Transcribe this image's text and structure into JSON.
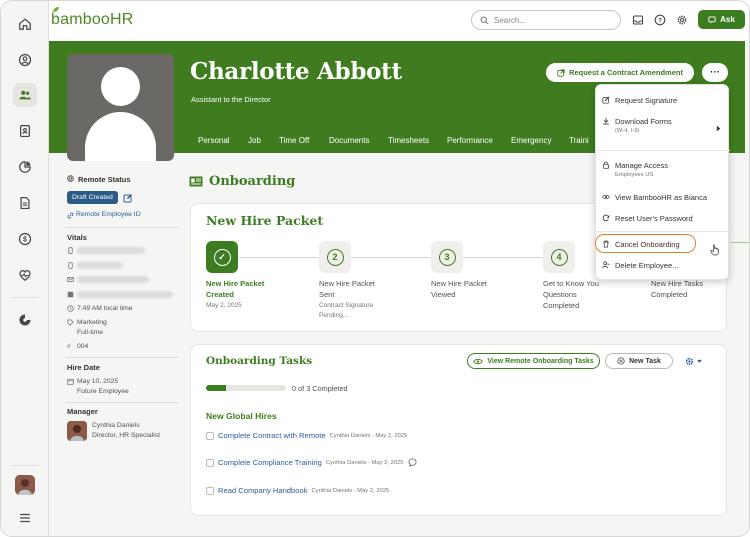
{
  "app": {
    "logo": "bambooHR"
  },
  "topbar": {
    "search_placeholder": "Search...",
    "ask_label": "Ask"
  },
  "rail": {
    "items": [
      "home-icon",
      "profile-icon",
      "people-icon",
      "id-card-icon",
      "reports-icon",
      "files-icon",
      "payroll-icon",
      "benefits-icon",
      "apps-icon"
    ]
  },
  "employee": {
    "name": "Charlotte Abbott",
    "title": "Assistant to the Director"
  },
  "header": {
    "request_button": "Request a Contract Amendment",
    "more_button": "···",
    "tabs": [
      "Personal",
      "Job",
      "Time Off",
      "Documents",
      "Timesheets",
      "Performance",
      "Emergency",
      "Traini"
    ]
  },
  "sidebar": {
    "remote_status_label": "Remote Status",
    "badge": "Draft Created",
    "remote_id_link": "Remote Employee ID",
    "vitals_label": "Vitals",
    "local_time": "7:49 AM local time",
    "department": "Marketing",
    "employment_type": "Full-time",
    "employee_number": "004",
    "hire_date_label": "Hire Date",
    "hire_date": "May 10, 2025",
    "hire_status": "Future Employee",
    "manager_label": "Manager",
    "manager_name": "Cynthia Daniels",
    "manager_title": "Director, HR Specialist"
  },
  "onboarding": {
    "title": "Onboarding",
    "packet_title": "New Hire Packet",
    "steps": [
      {
        "num": "✓",
        "label_1": "New Hire Packet",
        "label_2": "Created",
        "sub_1": "May 2, 2025",
        "sub_2": ""
      },
      {
        "num": "2",
        "label_1": "New Hire Packet",
        "label_2": "Sent",
        "sub_1": "Contract Signature",
        "sub_2": "Pending..."
      },
      {
        "num": "3",
        "label_1": "New Hire Packet",
        "label_2": "Viewed",
        "sub_1": "",
        "sub_2": ""
      },
      {
        "num": "4",
        "label_1": "Get to Know You",
        "label_2": "Questions",
        "label_3": "Completed"
      },
      {
        "label_1": "New Hire Tasks",
        "label_2": "Completed"
      }
    ],
    "tasks_title": "Onboarding Tasks",
    "view_remote_btn": "View Remote Onboarding Tasks",
    "new_task_btn": "New Task",
    "progress_text": "0 of 3 Completed",
    "progress_fraction": 0.25,
    "group_title": "New Global Hires",
    "tasks": [
      {
        "title": "Complete Contract with Remote",
        "meta": "Cynthia Daniels - May 2, 2025"
      },
      {
        "title": "Complete Compliance Training",
        "meta": "Cynthia Daniels - May 2, 2025"
      },
      {
        "title": "Read Company Handbook",
        "meta": "Cynthia Daniels - May 2, 2025"
      }
    ]
  },
  "menu": {
    "request_signature": "Request Signature",
    "download_forms": "Download Forms",
    "download_forms_sub": "(W-4, I-9)",
    "manage_access": "Manage Access",
    "manage_access_sub": "Employees US",
    "view_as": "View BambooHR as Bianca",
    "reset_password": "Reset User's Password",
    "cancel_onboarding": "Cancel Onboarding",
    "delete_employee": "Delete Employee..."
  },
  "colors": {
    "brand_green": "#3d7d22",
    "header_green": "#3f7c1f",
    "link_blue": "#2c5f9b",
    "highlight_orange": "#e0822b"
  }
}
